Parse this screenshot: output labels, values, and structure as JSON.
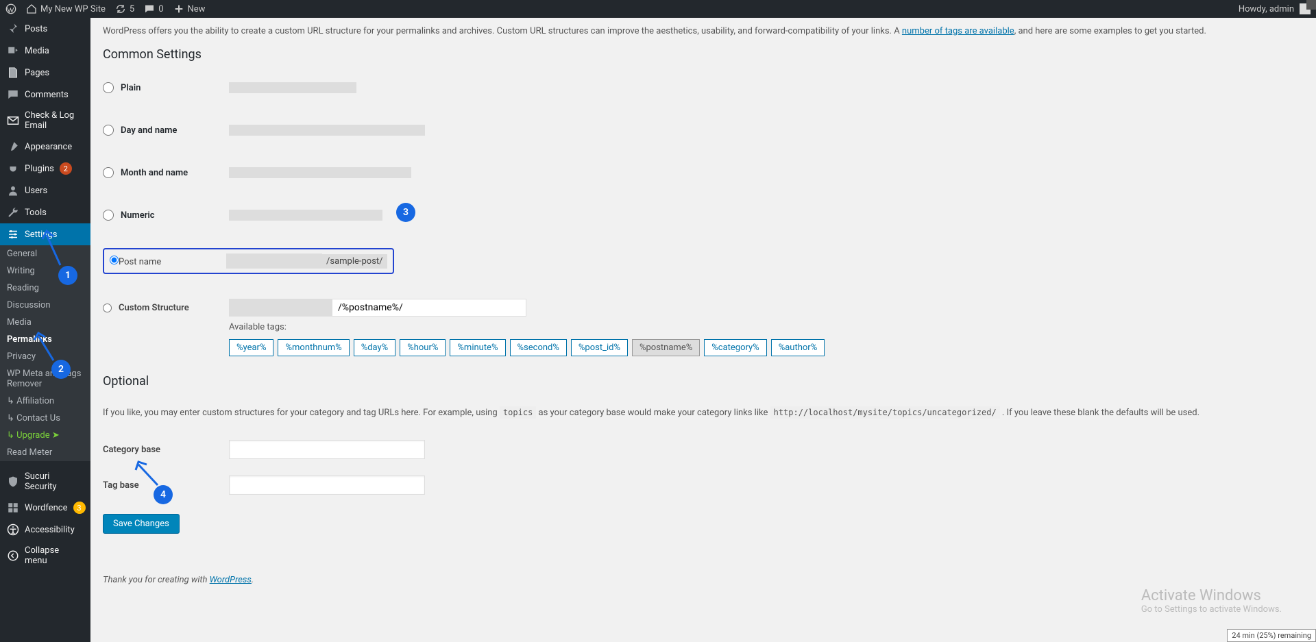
{
  "topbar": {
    "site_name": "My New WP Site",
    "refresh_count": "5",
    "comment_count": "0",
    "new_label": "New",
    "howdy": "Howdy, admin"
  },
  "sidebar_main": [
    {
      "id": "posts",
      "label": "Posts",
      "icon": "pin"
    },
    {
      "id": "media",
      "label": "Media",
      "icon": "media"
    },
    {
      "id": "pages",
      "label": "Pages",
      "icon": "page"
    },
    {
      "id": "comments",
      "label": "Comments",
      "icon": "comment"
    },
    {
      "id": "check-log",
      "label": "Check & Log Email",
      "icon": "mail"
    },
    {
      "id": "appearance",
      "label": "Appearance",
      "icon": "brush"
    },
    {
      "id": "plugins",
      "label": "Plugins",
      "icon": "plug",
      "badge": "2",
      "badge_color": "red"
    },
    {
      "id": "users",
      "label": "Users",
      "icon": "user"
    },
    {
      "id": "tools",
      "label": "Tools",
      "icon": "wrench"
    },
    {
      "id": "settings",
      "label": "Settings",
      "icon": "sliders",
      "selected": true
    }
  ],
  "sidebar_sub": [
    {
      "id": "general",
      "label": "General"
    },
    {
      "id": "writing",
      "label": "Writing"
    },
    {
      "id": "reading",
      "label": "Reading"
    },
    {
      "id": "discussion",
      "label": "Discussion"
    },
    {
      "id": "media",
      "label": "Media"
    },
    {
      "id": "permalinks",
      "label": "Permalinks",
      "selected": true
    },
    {
      "id": "privacy",
      "label": "Privacy"
    },
    {
      "id": "wpmeta",
      "label": "WP Meta and Tags Remover"
    },
    {
      "id": "affiliation",
      "label": "↳ Affiliation",
      "indent": true
    },
    {
      "id": "contact",
      "label": "↳ Contact Us",
      "indent": true
    },
    {
      "id": "upgrade",
      "label": "↳ Upgrade  ➤",
      "green": true,
      "indent": true
    },
    {
      "id": "readmeter",
      "label": "Read Meter"
    }
  ],
  "sidebar_bottom": [
    {
      "id": "sucuri",
      "label": "Sucuri Security",
      "icon": "shield"
    },
    {
      "id": "wordfence",
      "label": "Wordfence",
      "icon": "grid",
      "badge": "3",
      "badge_color": "yellow"
    },
    {
      "id": "accessibility",
      "label": "Accessibility",
      "icon": "access"
    },
    {
      "id": "collapse",
      "label": "Collapse menu",
      "icon": "collapse"
    }
  ],
  "intro": {
    "pre": "WordPress offers you the ability to create a custom URL structure for your permalinks and archives. Custom URL structures can improve the aesthetics, usability, and forward-compatibility of your links. A ",
    "link": "number of tags are available",
    "post": ", and here are some examples to get you started."
  },
  "sections": {
    "common": "Common Settings",
    "optional": "Optional"
  },
  "options": {
    "plain": "Plain",
    "day": "Day and name",
    "month": "Month and name",
    "numeric": "Numeric",
    "postname": "Post name",
    "postname_sample": "/sample-post/",
    "custom": "Custom Structure",
    "custom_value": "/%postname%/",
    "available": "Available tags:"
  },
  "tags": [
    "%year%",
    "%monthnum%",
    "%day%",
    "%hour%",
    "%minute%",
    "%second%",
    "%post_id%",
    "%postname%",
    "%category%",
    "%author%"
  ],
  "tag_selected": "%postname%",
  "optional_desc": {
    "p1": "If you like, you may enter custom structures for your category and tag URLs here. For example, using ",
    "code1": "topics",
    "p2": " as your category base would make your category links like ",
    "code2": "http://localhost/mysite/topics/uncategorized/",
    "p3": " . If you leave these blank the defaults will be used."
  },
  "labels": {
    "category_base": "Category base",
    "tag_base": "Tag base"
  },
  "save": "Save Changes",
  "footer": {
    "pre": "Thank you for creating with ",
    "link": "WordPress"
  },
  "activate": {
    "t1": "Activate Windows",
    "t2": "Go to Settings to activate Windows."
  },
  "battery": "24 min (25%) remaining",
  "annotations": {
    "a1": "1",
    "a2": "2",
    "a3": "3",
    "a4": "4"
  }
}
